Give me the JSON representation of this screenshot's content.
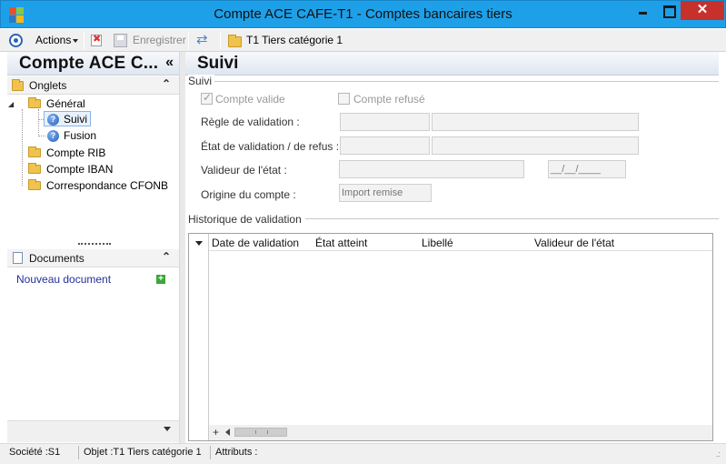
{
  "window": {
    "title": "Compte ACE CAFE-T1 -  Comptes bancaires tiers",
    "close_glyph": "✕"
  },
  "toolbar": {
    "actions_label": "Actions",
    "save_label": "Enregistrer",
    "object_label": "T1 Tiers catégorie 1",
    "refresh_glyph": "⇄"
  },
  "left_panel": {
    "title": "Compte ACE C...",
    "collapse_glyph": "«",
    "tabs_header": "Onglets",
    "tabs_chevron": "⌃",
    "tree": [
      {
        "label": "Général"
      },
      {
        "label": "Suivi"
      },
      {
        "label": "Fusion"
      },
      {
        "label": "Compte RIB"
      },
      {
        "label": "Compte IBAN"
      },
      {
        "label": "Correspondance CFONB"
      }
    ],
    "expander_glyph": "◢",
    "question_glyph": "?",
    "documents_header": "Documents",
    "documents_chevron": "⌃",
    "new_document_label": "Nouveau document",
    "plus_glyph": "+"
  },
  "main": {
    "title": "Suivi",
    "suivi_group_label": "Suivi",
    "compte_valide_label": "Compte valide",
    "compte_valide_checked": true,
    "compte_refuse_label": "Compte refusé",
    "compte_refuse_checked": false,
    "regle_label": "Règle de validation :",
    "etat_label": "État de validation / de refus :",
    "valideur_label": "Valideur de l'état :",
    "date_placeholder": "__/__/____",
    "origine_label": "Origine du compte :",
    "origine_value": "Import remise",
    "historique_label": "Historique de validation",
    "grid_columns": [
      "Date de validation",
      "État atteint",
      "Libellé",
      "Valideur de l'état"
    ],
    "grid_plus": "+"
  },
  "status_bar": {
    "societe": "Société :S1",
    "objet": "Objet :T1 Tiers catégorie 1",
    "attributs": "Attributs :",
    "grip": ".:"
  },
  "colors": {
    "titlebar": "#1ea0e8",
    "close_button": "#c7312b",
    "link": "#22309a",
    "selection": "#e8f2fd"
  }
}
